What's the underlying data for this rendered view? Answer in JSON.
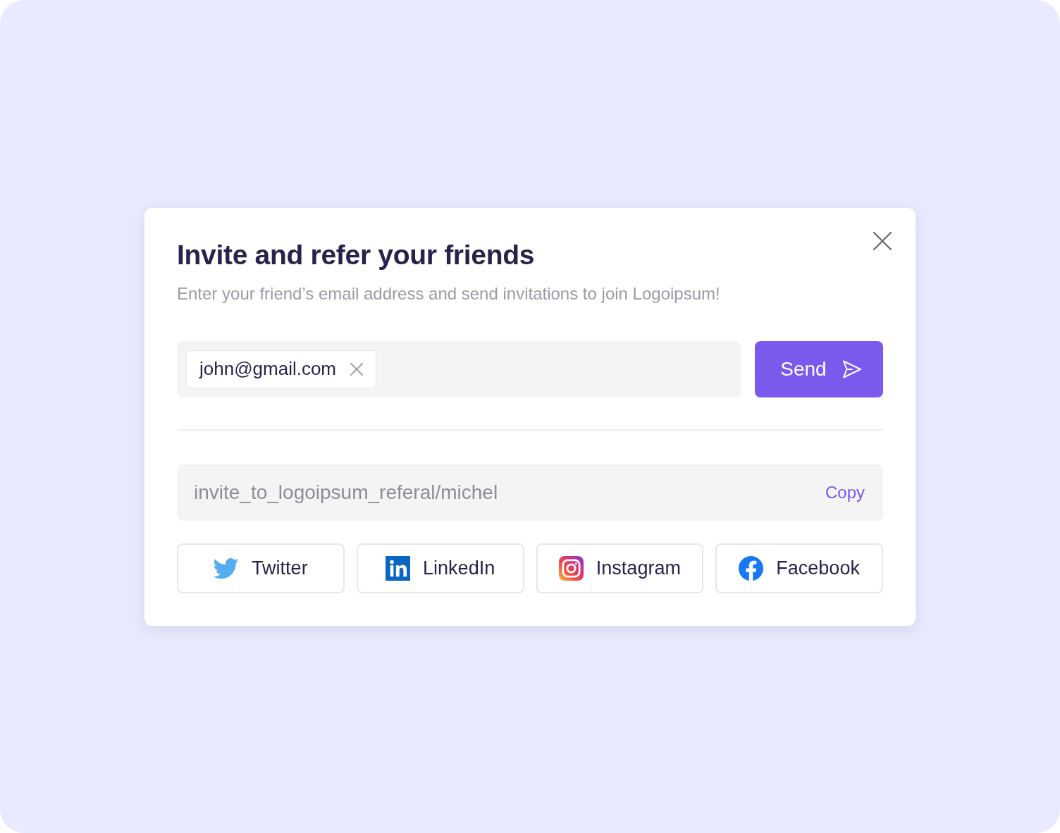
{
  "dialog": {
    "title": "Invite and refer your friends",
    "subtitle": "Enter your friend’s email address and send invitations to join Logoipsum!"
  },
  "email_field": {
    "chips": [
      {
        "value": "john@gmail.com"
      }
    ]
  },
  "send_button": {
    "label": "Send"
  },
  "referral_link": {
    "value": "invite_to_logoipsum_referal/michel",
    "action": "Copy"
  },
  "share_buttons": [
    {
      "kind": "twitter",
      "label": "Twitter"
    },
    {
      "kind": "linkedin",
      "label": "LinkedIn"
    },
    {
      "kind": "instagram",
      "label": "Instagram"
    },
    {
      "kind": "facebook",
      "label": "Facebook"
    }
  ]
}
